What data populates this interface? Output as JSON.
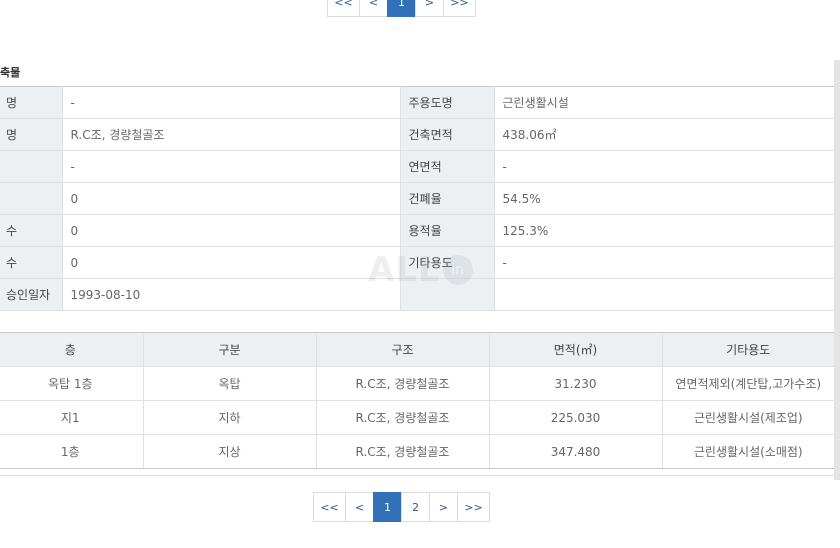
{
  "pagination_top": {
    "first": "<<",
    "prev": "<",
    "pages": [
      "1"
    ],
    "next": ">",
    "last": ">>"
  },
  "section_title": "축물",
  "info_rows": [
    {
      "l1": "명",
      "v1": "-",
      "l2": "주용도명",
      "v2": "근린생활시설"
    },
    {
      "l1": "명",
      "v1": "R.C조, 경량철골조",
      "l2": "건축면적",
      "v2": "438.06㎡"
    },
    {
      "l1": "",
      "v1": "-",
      "l2": "연면적",
      "v2": "-"
    },
    {
      "l1": "",
      "v1": "0",
      "l2": "건폐율",
      "v2": "54.5%"
    },
    {
      "l1": "수",
      "v1": "0",
      "l2": "용적율",
      "v2": "125.3%"
    },
    {
      "l1": "수",
      "v1": "0",
      "l2": "기타용도",
      "v2": "-"
    },
    {
      "l1": "승인일자",
      "v1": "1993-08-10",
      "l2": "",
      "v2": ""
    }
  ],
  "floors_table": {
    "headers": [
      "층",
      "구분",
      "구조",
      "면적(㎡)",
      "기타용도"
    ],
    "rows": [
      [
        "옥탑 1층",
        "옥탑",
        "R.C조, 경량철골조",
        "31.230",
        "연면적제외(계단탑,고가수조)"
      ],
      [
        "지1",
        "지하",
        "R.C조, 경량철골조",
        "225.030",
        "근린생활시설(제조업)"
      ],
      [
        "1층",
        "지상",
        "R.C조, 경량철골조",
        "347.480",
        "근린생활시설(소매점)"
      ]
    ]
  },
  "pagination_bottom": {
    "first": "<<",
    "prev": "<",
    "pages": [
      "1",
      "2"
    ],
    "next": ">",
    "last": ">>"
  },
  "watermark": {
    "text": "ALL",
    "badge": "in"
  },
  "colors": {
    "active_page": "#3271b8",
    "label_bg": "#edf0f3",
    "link": "#2a5d8f"
  }
}
